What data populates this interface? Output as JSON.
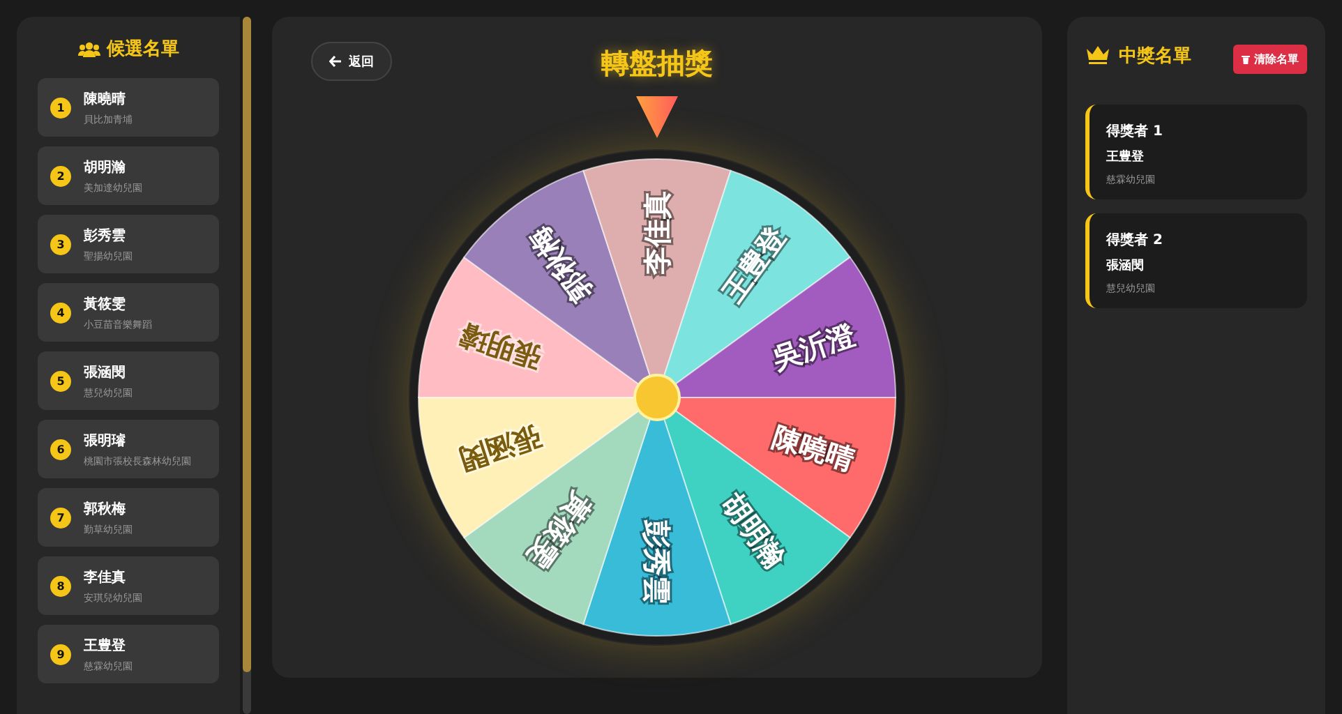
{
  "candidates": {
    "title": "候選名單",
    "items": [
      {
        "number": "1",
        "name": "陳曉晴",
        "school": "貝比加青埔"
      },
      {
        "number": "2",
        "name": "胡明瀚",
        "school": "美加達幼兒園"
      },
      {
        "number": "3",
        "name": "彭秀雲",
        "school": "聖揚幼兒園"
      },
      {
        "number": "4",
        "name": "黃筱雯",
        "school": "小豆苗音樂舞蹈"
      },
      {
        "number": "5",
        "name": "張涵閔",
        "school": "慧兒幼兒園"
      },
      {
        "number": "6",
        "name": "張明璿",
        "school": "桃園市張校長森林幼兒園"
      },
      {
        "number": "7",
        "name": "郭秋梅",
        "school": "勤草幼兒園"
      },
      {
        "number": "8",
        "name": "李佳真",
        "school": "安琪兒幼兒園"
      },
      {
        "number": "9",
        "name": "王豊登",
        "school": "慈霖幼兒園"
      }
    ]
  },
  "wheel": {
    "back_button": "返回",
    "title": "轉盤抽獎",
    "segments": [
      {
        "label": "陳曉晴",
        "color": "#ff6b6b"
      },
      {
        "label": "胡明瀚",
        "color": "#3fd1c2"
      },
      {
        "label": "彭秀雲",
        "color": "#38bcd8"
      },
      {
        "label": "黃筱雯",
        "color": "#a3d9bd"
      },
      {
        "label": "張涵閔",
        "color": "#fff0b8"
      },
      {
        "label": "張明璿",
        "color": "#ffbcc2"
      },
      {
        "label": "郭秋梅",
        "color": "#9a80b8"
      },
      {
        "label": "李佳真",
        "color": "#deaeae"
      },
      {
        "label": "王豊登",
        "color": "#7de3de"
      },
      {
        "label": "吳沂澄",
        "color": "#a25cc0"
      }
    ]
  },
  "winners": {
    "title": "中獎名單",
    "clear_button": "清除名單",
    "items": [
      {
        "title": "得獎者 1",
        "name": "王豊登",
        "school": "慈霖幼兒園"
      },
      {
        "title": "得獎者 2",
        "name": "張涵閔",
        "school": "慧兒幼兒園"
      }
    ]
  }
}
